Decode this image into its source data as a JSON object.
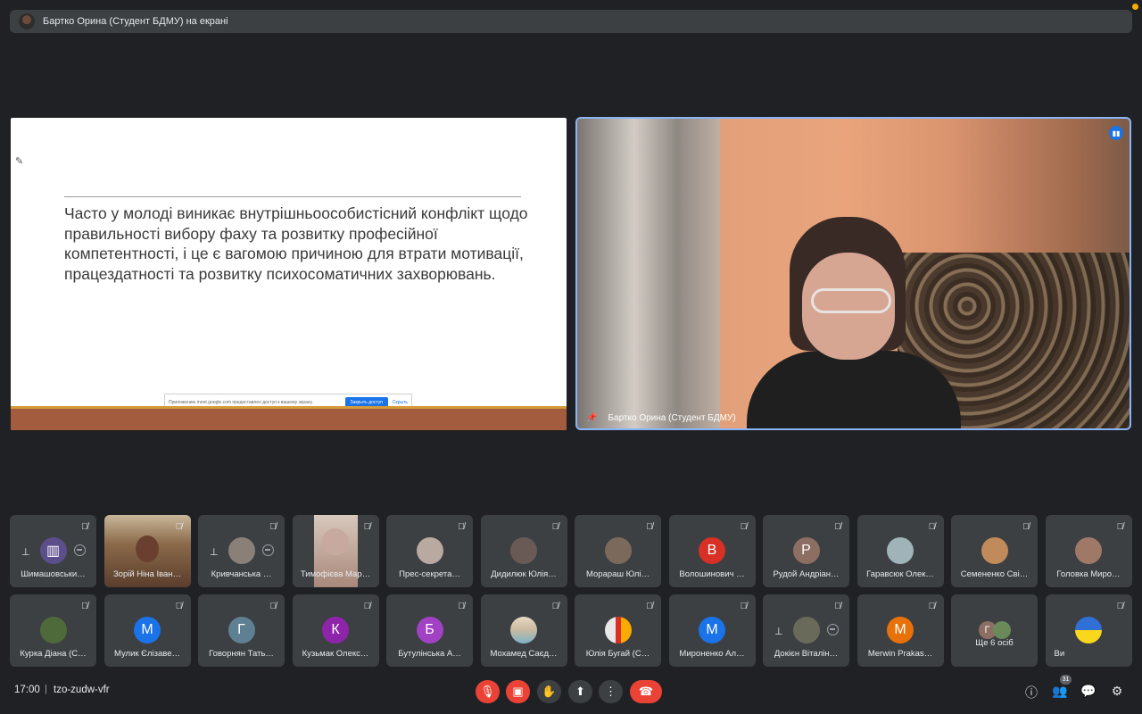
{
  "topbar": {
    "title": "Бартко Орина (Студент БДМУ) на екрані"
  },
  "slide": {
    "text": "Часто у молоді виникає внутрішньоособистісний конфлікт щодо правильності вибору фаху та розвитку професійної компетентності, і це є вагомою причиною для втрати  мотивації, працездатності та розвитку психосоматичних захворювань.",
    "share_message": "Приложению meet.google.com предоставлен доступ к вашему экрану.",
    "stop_button": "Закрыть доступ",
    "hide_link": "Скрыть"
  },
  "camera": {
    "name": "Бартко Орина (Студент БДМУ)"
  },
  "participants_row1": [
    {
      "name": "Шимашовськи…",
      "initial": "",
      "color": "#5c4e8a"
    },
    {
      "name": "Зорій Ніна Іван…",
      "initial": "",
      "color": "#7a5d3f"
    },
    {
      "name": "Кривчанська …",
      "initial": "",
      "color": "#8a8078"
    },
    {
      "name": "Тимофієва Мар…",
      "initial": "",
      "color": "#c8a9a0"
    },
    {
      "name": "Прес-секрета…",
      "initial": "",
      "color": "#b8aaa0"
    },
    {
      "name": "Дидилюк Юлія…",
      "initial": "",
      "color": "#6a5a55"
    },
    {
      "name": "Морараш Юлі…",
      "initial": "",
      "color": "#7b6a5c"
    },
    {
      "name": "Волошинович …",
      "initial": "В",
      "color": "#d93025"
    },
    {
      "name": "Рудой Андріан…",
      "initial": "Р",
      "color": "#8d6e63"
    },
    {
      "name": "Гаравсюк Олек…",
      "initial": "",
      "color": "#9fb3b8"
    },
    {
      "name": "Семененко Сві…",
      "initial": "",
      "color": "#c08a5a"
    },
    {
      "name": "Головка Миро…",
      "initial": "",
      "color": "#a07868"
    }
  ],
  "participants_row2": [
    {
      "name": "Курка Діана (С…",
      "initial": "",
      "color": "#4f6a3a"
    },
    {
      "name": "Мулик Єлізаве…",
      "initial": "М",
      "color": "#1a73e8"
    },
    {
      "name": "Говорнян Тать…",
      "initial": "Г",
      "color": "#5f7f92"
    },
    {
      "name": "Кузьмак Олекс…",
      "initial": "К",
      "color": "#8e24aa"
    },
    {
      "name": "Бутулінська А…",
      "initial": "Б",
      "color": "#a142c4"
    },
    {
      "name": "Мохамед Саєд…",
      "initial": "",
      "color": "#c8b9a0"
    },
    {
      "name": "Юлія Бугай (С…",
      "initial": "",
      "color": "#e8e8e8"
    },
    {
      "name": "Мироненко Ал…",
      "initial": "М",
      "color": "#1a73e8"
    },
    {
      "name": "Докієн Віталін…",
      "initial": "",
      "color": "#6a6a5a"
    },
    {
      "name": "Merwin Prakas…",
      "initial": "M",
      "color": "#e8710a"
    },
    {
      "name": "Ще 6 осіб",
      "initial": "Г",
      "color": "#8d6e63"
    },
    {
      "name": "Ви",
      "initial": "",
      "color": "#2f6fd6"
    }
  ],
  "bottom": {
    "time": "17:00",
    "separator": "|",
    "meeting_code": "tzo-zudw-vfr",
    "participants_count": "31"
  },
  "colors": {
    "accent": "#8ab4f8",
    "danger": "#ea4335",
    "surface": "#3c4043",
    "background": "#202124"
  }
}
